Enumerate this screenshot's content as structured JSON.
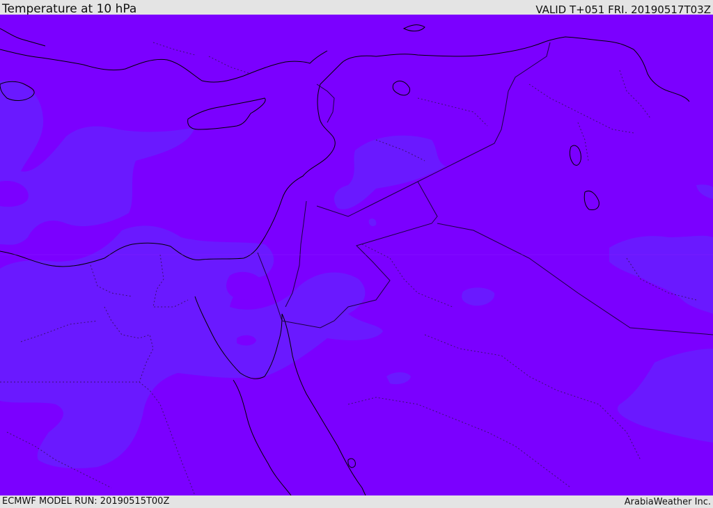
{
  "header": {
    "title": "Temperature at 10 hPa",
    "valid": "VALID T+051 FRI. 20190517T03Z"
  },
  "footer": {
    "model_run": "ECMWF MODEL RUN: 20190515T00Z",
    "credit": "ArabiaWeather Inc."
  },
  "map": {
    "field": "temperature",
    "level": "10 hPa",
    "colors": {
      "background_fill": "#7b00ff",
      "lighter_band_fill": "#6a19ff",
      "coastline": "#000000",
      "border": "#1a0040",
      "background_bar": "#e4e4e4"
    }
  }
}
